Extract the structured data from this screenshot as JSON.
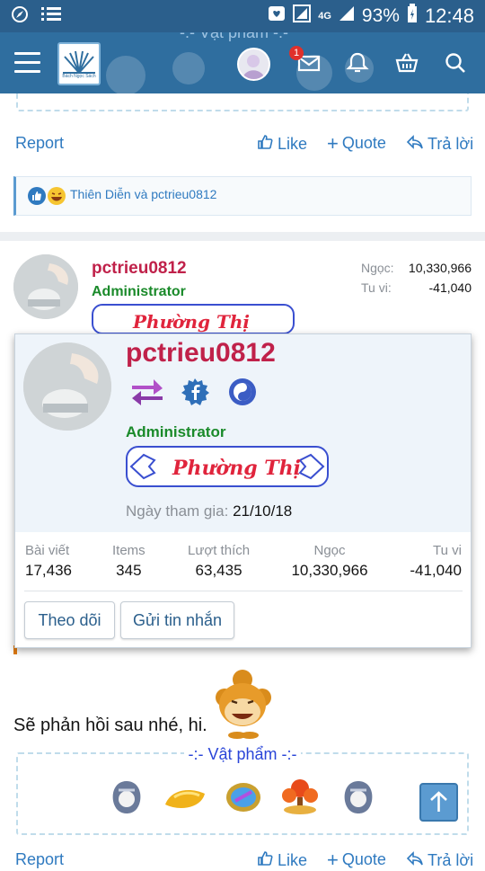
{
  "status_bar": {
    "battery": "93%",
    "time": "12:48",
    "network": "4G"
  },
  "app_bar": {
    "logo_text": "Bách Ngọc Sách",
    "inbox_badge": "1",
    "behind_banner_text": "-:- Vật phẩm -:-"
  },
  "post1": {
    "report": "Report",
    "like": "Like",
    "quote": "Quote",
    "reply": "Trả lời",
    "reactions_text": "Thiên Diễn và pctrieu0812"
  },
  "post2": {
    "username": "pctrieu0812",
    "role": "Administrator",
    "title_banner": "Phường Thị",
    "stats": [
      {
        "label": "Ngọc:",
        "value": "10,330,966"
      },
      {
        "label": "Tu vi:",
        "value": "-41,040"
      }
    ],
    "message": "Sẽ phản hồi sau nhé, hi.",
    "items_title": "-:- Vật phẩm -:-",
    "report": "Report",
    "like": "Like",
    "quote": "Quote",
    "reply": "Trả lời"
  },
  "popup": {
    "username": "pctrieu0812",
    "role": "Administrator",
    "title_banner": "Phường Thị",
    "joined_label": "Ngày tham gia:",
    "joined_value": "21/10/18",
    "stats": [
      {
        "label": "Bài viết",
        "value": "17,436"
      },
      {
        "label": "Items",
        "value": "345"
      },
      {
        "label": "Lượt thích",
        "value": "63,435"
      },
      {
        "label": "Ngọc",
        "value": "10,330,966"
      },
      {
        "label": "Tu vi",
        "value": "-41,040"
      }
    ],
    "follow_button": "Theo dõi",
    "message_button": "Gửi tin nhắn"
  },
  "colors": {
    "header": "#2f6e9f",
    "link": "#2f7ac0",
    "username": "#c0214a",
    "admin": "#1a8a2a"
  }
}
